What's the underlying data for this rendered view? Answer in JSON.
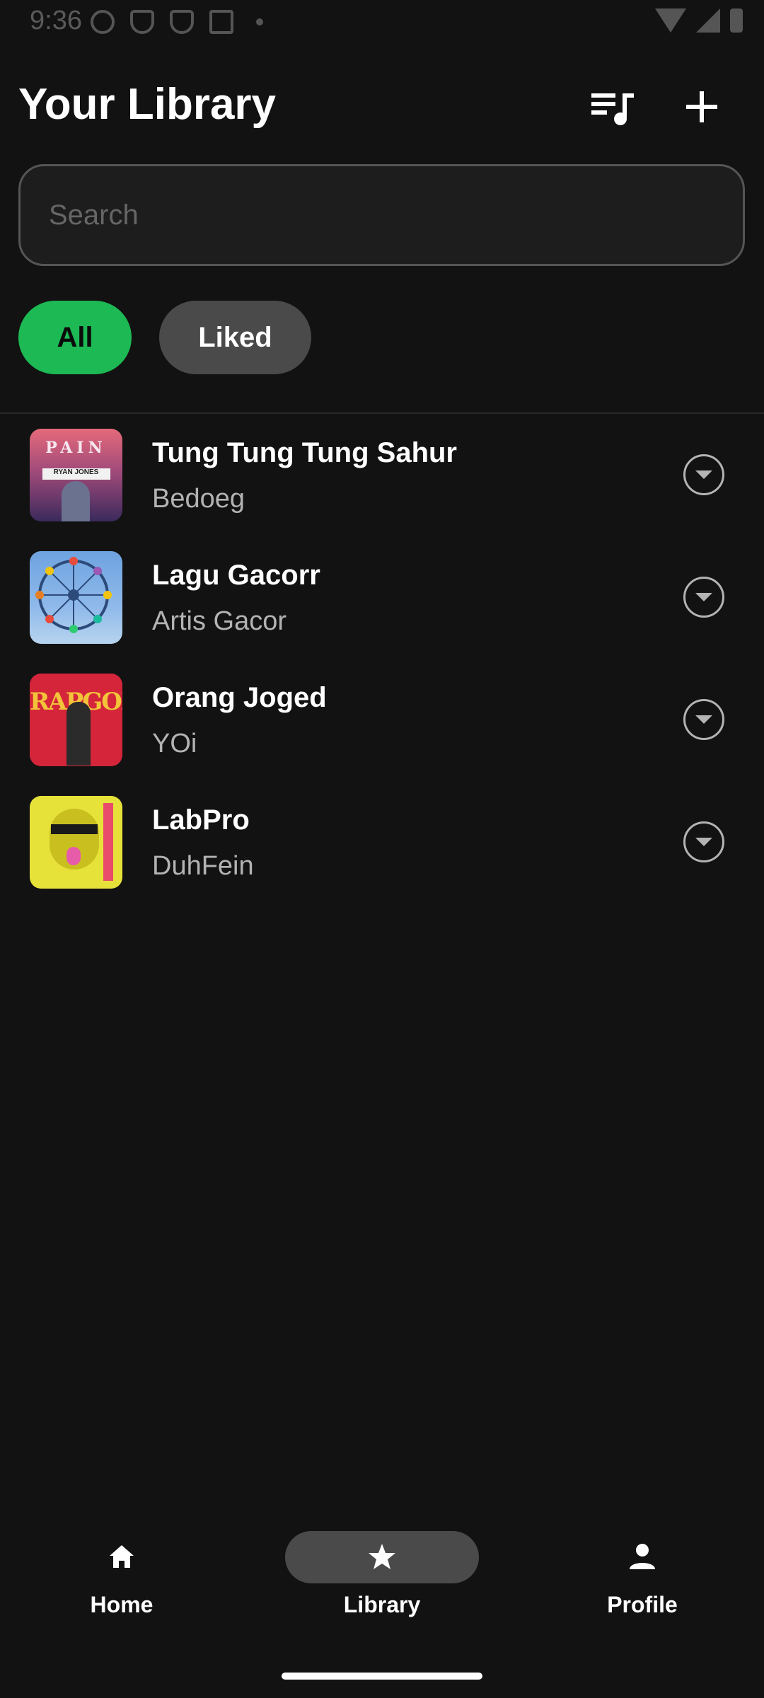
{
  "status_bar": {
    "time": "9:36"
  },
  "header": {
    "title": "Your Library",
    "queue_icon": "queue-music-icon",
    "add_icon": "plus-icon"
  },
  "search": {
    "placeholder": "Search",
    "value": ""
  },
  "filters": [
    {
      "label": "All",
      "selected": true
    },
    {
      "label": "Liked",
      "selected": false
    }
  ],
  "songs": [
    {
      "title": "Tung Tung Tung Sahur",
      "artist": "Bedoeg",
      "cover_text_top": "PAIN",
      "cover_text_band": "RYAN JONES"
    },
    {
      "title": "Lagu Gacorr",
      "artist": "Artis Gacor"
    },
    {
      "title": "Orang Joged",
      "artist": "YOi",
      "cover_text": "RAPGOD"
    },
    {
      "title": "LabPro",
      "artist": "DuhFein"
    }
  ],
  "bottom_nav": {
    "items": [
      {
        "label": "Home",
        "icon": "home-icon",
        "active": false
      },
      {
        "label": "Library",
        "icon": "star-icon",
        "active": true
      },
      {
        "label": "Profile",
        "icon": "person-icon",
        "active": false
      }
    ]
  },
  "colors": {
    "background": "#121212",
    "accent": "#1DB954",
    "chip_inactive": "#4a4a4a",
    "secondary_text": "#b3b3b3"
  }
}
